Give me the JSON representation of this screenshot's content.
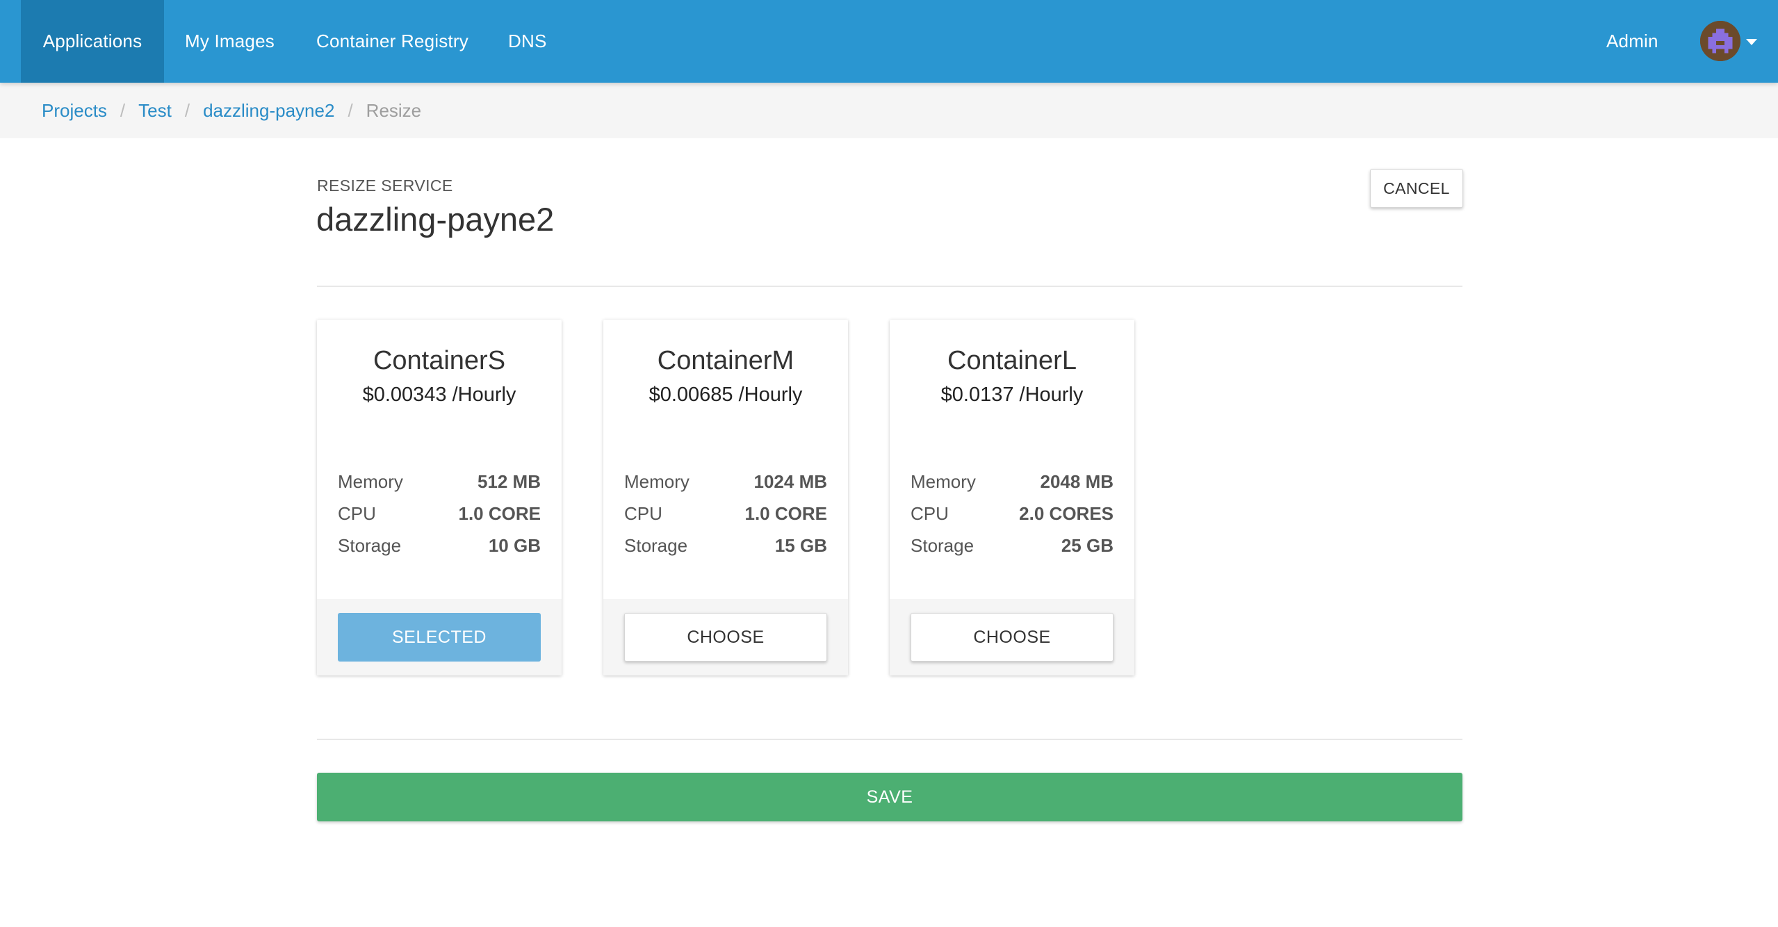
{
  "nav": {
    "items": [
      {
        "label": "Applications",
        "active": true
      },
      {
        "label": "My Images",
        "active": false
      },
      {
        "label": "Container Registry",
        "active": false
      },
      {
        "label": "DNS",
        "active": false
      }
    ],
    "user_label": "Admin",
    "avatar_icon": "pixel-avatar-icon",
    "dropdown_icon": "caret-down-icon"
  },
  "breadcrumb": {
    "items": [
      "Projects",
      "Test",
      "dazzling-payne2"
    ],
    "separator": "/",
    "current": "Resize"
  },
  "header": {
    "subtitle": "RESIZE SERVICE",
    "title": "dazzling-payne2",
    "cancel_label": "CANCEL"
  },
  "plans": [
    {
      "name": "ContainerS",
      "price": "$0.00343 /Hourly",
      "specs": [
        {
          "label": "Memory",
          "value": "512 MB"
        },
        {
          "label": "CPU",
          "value": "1.0 CORE"
        },
        {
          "label": "Storage",
          "value": "10 GB"
        }
      ],
      "button_label": "SELECTED",
      "selected": true
    },
    {
      "name": "ContainerM",
      "price": "$0.00685 /Hourly",
      "specs": [
        {
          "label": "Memory",
          "value": "1024 MB"
        },
        {
          "label": "CPU",
          "value": "1.0 CORE"
        },
        {
          "label": "Storage",
          "value": "15 GB"
        }
      ],
      "button_label": "CHOOSE",
      "selected": false
    },
    {
      "name": "ContainerL",
      "price": "$0.0137 /Hourly",
      "specs": [
        {
          "label": "Memory",
          "value": "2048 MB"
        },
        {
          "label": "CPU",
          "value": "2.0 CORES"
        },
        {
          "label": "Storage",
          "value": "25 GB"
        }
      ],
      "button_label": "CHOOSE",
      "selected": false
    }
  ],
  "save_label": "SAVE",
  "colors": {
    "nav_bg": "#2a96d1",
    "nav_active_bg": "#1c7bb0",
    "link": "#2a8cc7",
    "selected_button": "#6db3de",
    "save_button": "#4caf72"
  }
}
